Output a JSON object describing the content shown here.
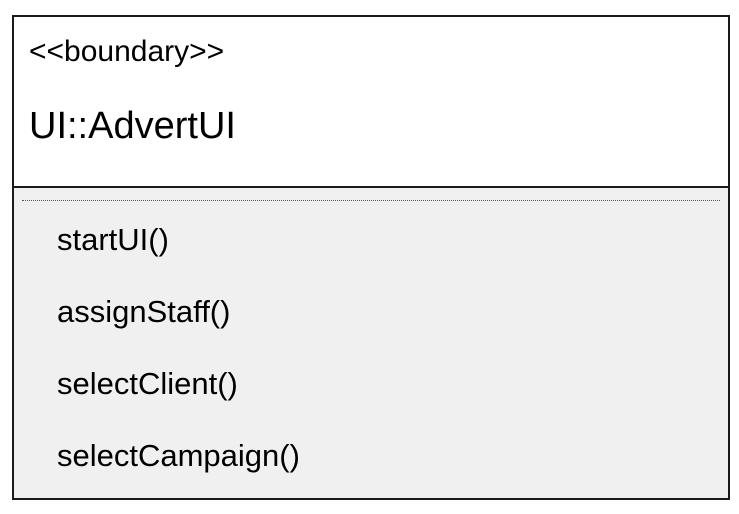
{
  "class": {
    "stereotype": "<<boundary>>",
    "name": "UI::AdvertUI",
    "operations": [
      "startUI()",
      "assignStaff()",
      "selectClient()",
      "selectCampaign()"
    ]
  },
  "colors": {
    "border": "#1a1a1a",
    "operations_background": "#f0f0f0",
    "header_background": "#ffffff"
  }
}
